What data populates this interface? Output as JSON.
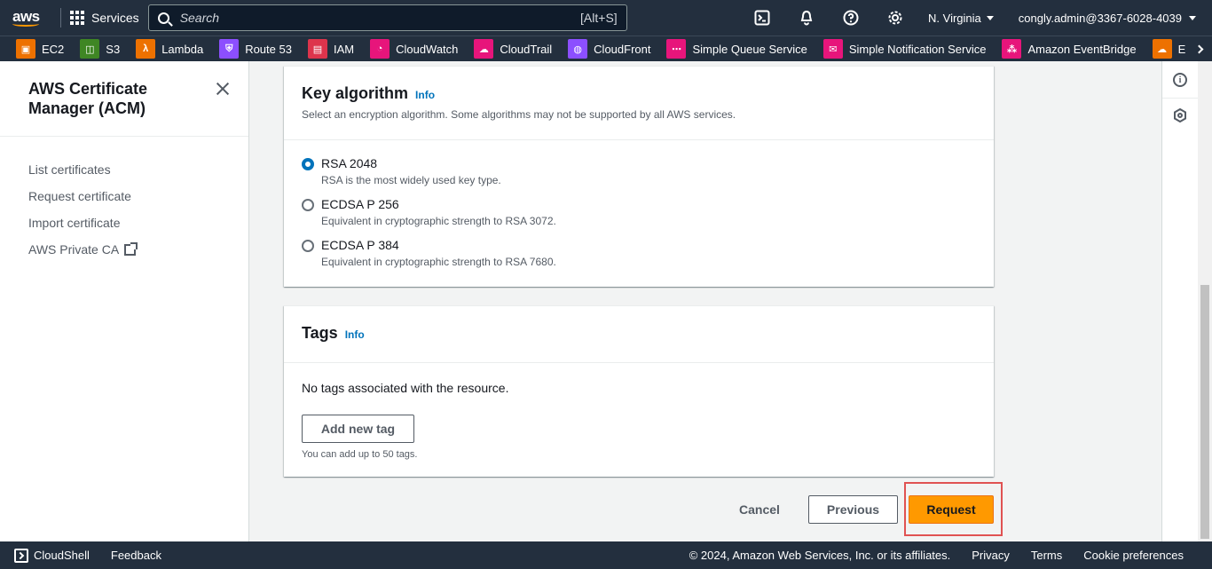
{
  "topnav": {
    "logo_text": "aws",
    "services_label": "Services",
    "search_placeholder": "Search",
    "search_shortcut": "[Alt+S]",
    "region": "N. Virginia",
    "account": "congly.admin@3367-6028-4039"
  },
  "favorites": [
    {
      "label": "EC2",
      "color": "#ed7100"
    },
    {
      "label": "S3",
      "color": "#3f8624"
    },
    {
      "label": "Lambda",
      "color": "#ed7100"
    },
    {
      "label": "Route 53",
      "color": "#8c4fff"
    },
    {
      "label": "IAM",
      "color": "#dd344c"
    },
    {
      "label": "CloudWatch",
      "color": "#e7157b"
    },
    {
      "label": "CloudTrail",
      "color": "#e7157b"
    },
    {
      "label": "CloudFront",
      "color": "#8c4fff"
    },
    {
      "label": "Simple Queue Service",
      "color": "#e7157b"
    },
    {
      "label": "Simple Notification Service",
      "color": "#e7157b"
    },
    {
      "label": "Amazon EventBridge",
      "color": "#e7157b"
    },
    {
      "label": "Elastic Beans",
      "color": "#ed7100"
    }
  ],
  "sidebar": {
    "title": "AWS Certificate Manager (ACM)",
    "items": [
      {
        "label": "List certificates"
      },
      {
        "label": "Request certificate"
      },
      {
        "label": "Import certificate"
      },
      {
        "label": "AWS Private CA"
      }
    ]
  },
  "key_algorithm": {
    "title": "Key algorithm",
    "info": "Info",
    "description": "Select an encryption algorithm. Some algorithms may not be supported by all AWS services.",
    "options": [
      {
        "label": "RSA 2048",
        "desc": "RSA is the most widely used key type.",
        "selected": true
      },
      {
        "label": "ECDSA P 256",
        "desc": "Equivalent in cryptographic strength to RSA 3072.",
        "selected": false
      },
      {
        "label": "ECDSA P 384",
        "desc": "Equivalent in cryptographic strength to RSA 7680.",
        "selected": false
      }
    ]
  },
  "tags": {
    "title": "Tags",
    "info": "Info",
    "empty": "No tags associated with the resource.",
    "add_button": "Add new tag",
    "hint": "You can add up to 50 tags."
  },
  "actions": {
    "cancel": "Cancel",
    "previous": "Previous",
    "request": "Request"
  },
  "footer": {
    "cloudshell": "CloudShell",
    "feedback": "Feedback",
    "copyright": "© 2024, Amazon Web Services, Inc. or its affiliates.",
    "privacy": "Privacy",
    "terms": "Terms",
    "cookie": "Cookie preferences"
  },
  "colors": {
    "nav_bg": "#232f3e",
    "primary_button": "#ff9900",
    "link": "#0073bb",
    "highlight": "#e05252"
  }
}
